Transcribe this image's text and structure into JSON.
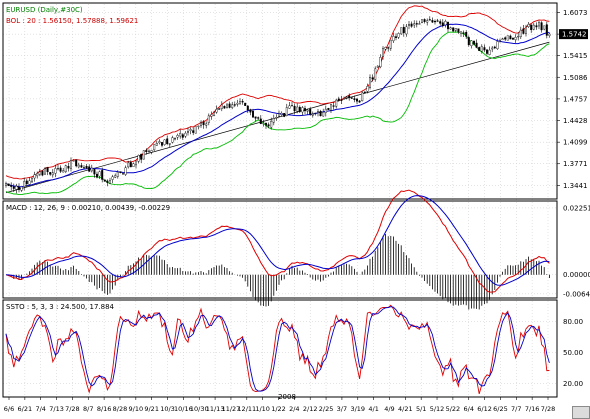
{
  "chart_data": {
    "type": "candlestick",
    "symbol": "EURUSD (Daily,#30C)",
    "header_colors": {
      "symbol": "#008000",
      "bollinger": "#cc0000"
    },
    "colors": {
      "background": "#ffffff",
      "grid": "#c8c8c8",
      "frame": "#000000",
      "candle_up": "#ffffff",
      "candle_down": "#000000",
      "bol_upper": "#dd0000",
      "bol_middle": "#0000cc",
      "bol_lower": "#00bb00",
      "trendline": "#000000",
      "macd_line": "#dd0000",
      "macd_signal": "#0000cc",
      "macd_histogram": "#000000",
      "stoch_k": "#dd0000",
      "stoch_d": "#0000cc"
    },
    "price_panel": {
      "legend": "BOL : 20 : 1.56150, 1.57888, 1.59621",
      "ylim": [
        1.325,
        1.62
      ],
      "y_ticks": [
        1.3441,
        1.3771,
        1.4099,
        1.4428,
        1.4757,
        1.5086,
        1.5415,
        1.5742,
        1.6073
      ],
      "last_price": 1.5742,
      "trendline": {
        "from": [
          0,
          1.333
        ],
        "to": [
          209,
          1.562
        ]
      },
      "anchors": [
        [
          0,
          1.348
        ],
        [
          5,
          1.342
        ],
        [
          10,
          1.356
        ],
        [
          15,
          1.365
        ],
        [
          20,
          1.368
        ],
        [
          25,
          1.378
        ],
        [
          30,
          1.372
        ],
        [
          35,
          1.362
        ],
        [
          40,
          1.351
        ],
        [
          45,
          1.365
        ],
        [
          50,
          1.384
        ],
        [
          55,
          1.397
        ],
        [
          60,
          1.407
        ],
        [
          65,
          1.416
        ],
        [
          70,
          1.424
        ],
        [
          75,
          1.436
        ],
        [
          80,
          1.452
        ],
        [
          85,
          1.468
        ],
        [
          90,
          1.47
        ],
        [
          95,
          1.452
        ],
        [
          100,
          1.435
        ],
        [
          105,
          1.447
        ],
        [
          110,
          1.463
        ],
        [
          115,
          1.46
        ],
        [
          120,
          1.451
        ],
        [
          125,
          1.465
        ],
        [
          130,
          1.474
        ],
        [
          135,
          1.47
        ],
        [
          140,
          1.502
        ],
        [
          145,
          1.548
        ],
        [
          150,
          1.573
        ],
        [
          155,
          1.586
        ],
        [
          160,
          1.592
        ],
        [
          165,
          1.594
        ],
        [
          170,
          1.587
        ],
        [
          175,
          1.575
        ],
        [
          180,
          1.556
        ],
        [
          185,
          1.55
        ],
        [
          190,
          1.563
        ],
        [
          195,
          1.572
        ],
        [
          200,
          1.582
        ],
        [
          205,
          1.59
        ],
        [
          209,
          1.574
        ]
      ]
    },
    "macd_panel": {
      "legend": "MACD : 12, 26, 9 : 0.00210, 0.00439, -0.00229",
      "ylim": [
        -0.0075,
        0.0245
      ],
      "y_ticks": [
        0.02251,
        0.0,
        -0.00644
      ]
    },
    "stoch_panel": {
      "legend": "SSTO : 5, 3, 3 : 24.500, 17.884",
      "ylim": [
        8,
        100
      ],
      "y_ticks": [
        80.0,
        50.0,
        20.0
      ]
    },
    "x_axis": {
      "year_label": "2008",
      "tick_labels": [
        "6/6",
        "6/21",
        "7/4",
        "7/13",
        "7/28",
        "8/7",
        "8/16",
        "8/28",
        "9/10",
        "9/21",
        "10/3",
        "10/16",
        "10/30",
        "11/13",
        "11/27",
        "12/11",
        "1/10",
        "1/22",
        "2/4",
        "2/12",
        "2/25",
        "3/7",
        "3/19",
        "4/1",
        "4/9",
        "4/21",
        "5/1",
        "5/12",
        "5/22",
        "6/4",
        "6/12",
        "6/25",
        "7/7",
        "7/16",
        "7/28"
      ]
    }
  },
  "badge_label": ""
}
